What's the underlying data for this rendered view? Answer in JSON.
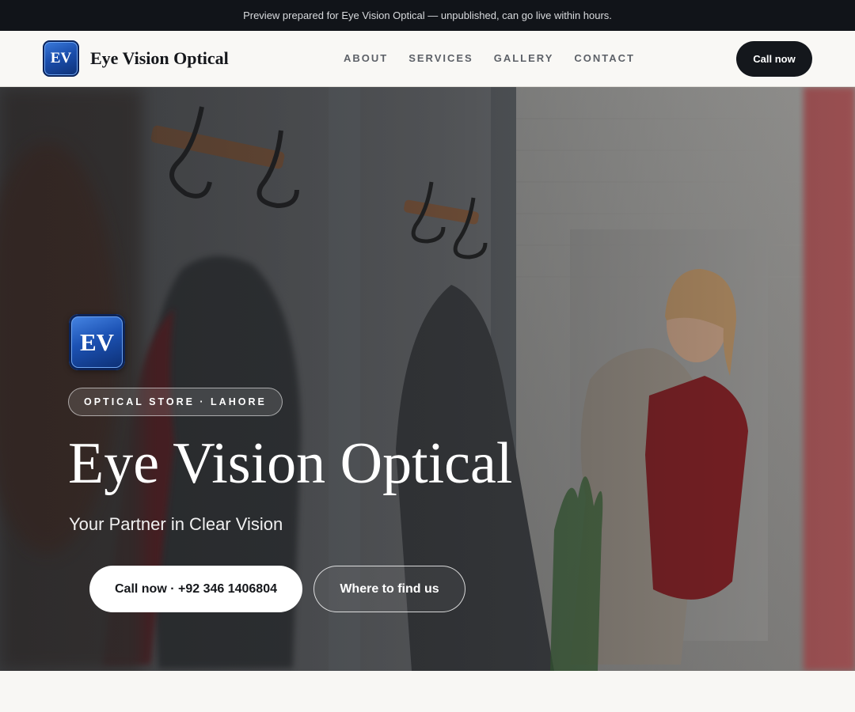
{
  "topbar": {
    "notice": "Preview prepared for Eye Vision Optical — unpublished, can go live within hours."
  },
  "header": {
    "logo_text": "EV",
    "brand_name": "Eye Vision Optical",
    "nav": [
      {
        "label": "ABOUT"
      },
      {
        "label": "SERVICES"
      },
      {
        "label": "GALLERY"
      },
      {
        "label": "CONTACT"
      }
    ],
    "cta_label": "Call now"
  },
  "hero": {
    "logo_text": "EV",
    "badge": "OPTICAL STORE · LAHORE",
    "title": "Eye Vision Optical",
    "subtitle": "Your Partner in Clear Vision",
    "primary_button": "Call now · +92 346 1406804",
    "secondary_button": "Where to find us",
    "background": "photo of a woman trying on clothes in a boutique mirror"
  },
  "colors": {
    "topbar_bg": "#111419",
    "navbar_bg": "#f9f8f5",
    "cta_bg": "#14171c",
    "logo_blue": "#1b4fae",
    "page_bg": "#f8f7f4"
  }
}
